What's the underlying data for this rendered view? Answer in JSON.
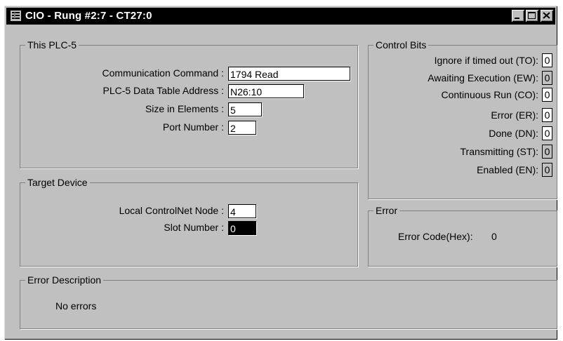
{
  "window": {
    "title": "CIO - Rung #2:7 - CT27:0",
    "buttons": [
      "minimize-icon",
      "maximize-icon",
      "close-icon"
    ]
  },
  "this_plc5": {
    "label": "This PLC-5",
    "fields": {
      "comm_command": {
        "label": "Communication Command :",
        "value": "1794 Read"
      },
      "table_address": {
        "label": "PLC-5 Data Table Address :",
        "value": "N26:10"
      },
      "size": {
        "label": "Size in Elements :",
        "value": "5"
      },
      "port": {
        "label": "Port Number :",
        "value": "2"
      }
    }
  },
  "target_device": {
    "label": "Target Device",
    "fields": {
      "node": {
        "label": "Local ControlNet Node :",
        "value": "4"
      },
      "slot": {
        "label": "Slot Number :",
        "value": "0"
      }
    }
  },
  "control_bits": {
    "label": "Control Bits",
    "items": [
      {
        "label": "Ignore if timed out (TO):",
        "value": "0"
      },
      {
        "label": "Awaiting Execution (EW):",
        "value": "0"
      },
      {
        "label": "Continuous Run (CO):",
        "value": "0"
      },
      {
        "label": "Error (ER):",
        "value": "0"
      },
      {
        "label": "Done (DN):",
        "value": "0"
      },
      {
        "label": "Transmitting (ST):",
        "value": "0"
      },
      {
        "label": "Enabled (EN):",
        "value": "0"
      }
    ]
  },
  "error": {
    "label": "Error",
    "code_label": "Error Code(Hex):",
    "code_value": "0"
  },
  "error_description": {
    "label": "Error Description",
    "text": "No errors"
  }
}
